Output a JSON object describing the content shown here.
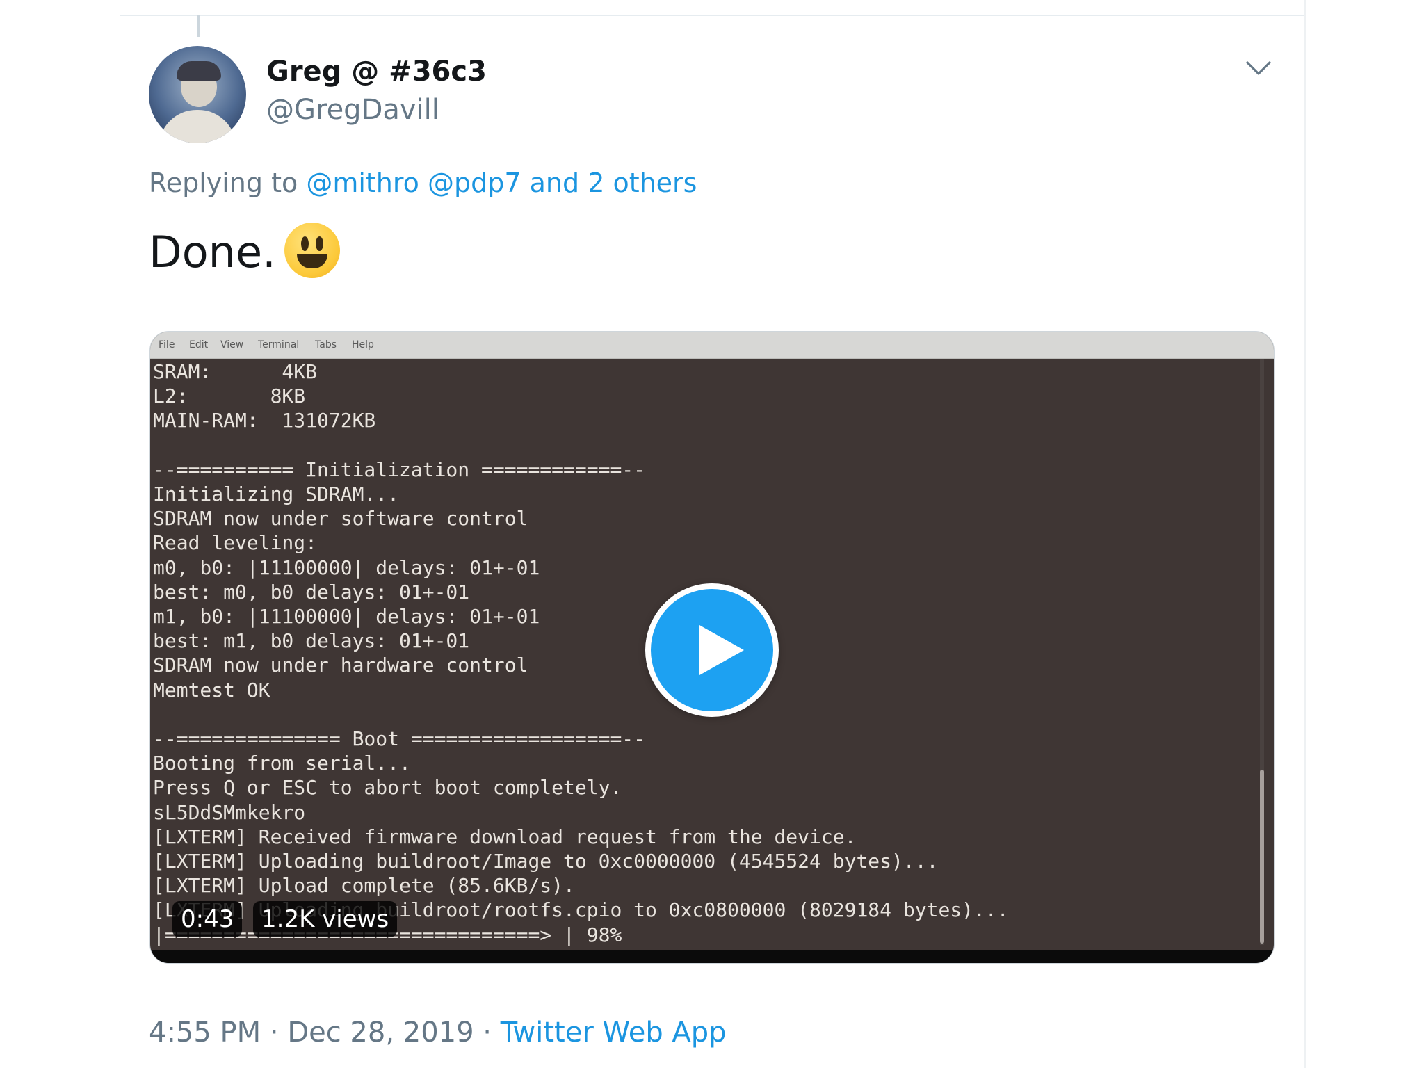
{
  "tweet": {
    "display_name": "Greg @ #36c3",
    "handle": "@GregDavill",
    "replying_prefix": "Replying to",
    "replying_links": "@mithro @pdp7 and 2 others",
    "text": "Done.",
    "emoji_name": "smiley-emoji",
    "timestamp": "4:55 PM · Dec 28, 2019 ·",
    "source": "Twitter Web App"
  },
  "video": {
    "menu": [
      "File",
      "Edit",
      "View",
      "Terminal",
      "Tabs",
      "Help"
    ],
    "duration": "0:43",
    "views": "1.2K views",
    "terminal_lines": [
      "SRAM:      4KB",
      "L2:       8KB",
      "MAIN-RAM:  131072KB",
      "",
      "--========== Initialization ============--",
      "Initializing SDRAM...",
      "SDRAM now under software control",
      "Read leveling:",
      "m0, b0: |11100000| delays: 01+-01",
      "best: m0, b0 delays: 01+-01",
      "m1, b0: |11100000| delays: 01+-01",
      "best: m1, b0 delays: 01+-01",
      "SDRAM now under hardware control",
      "Memtest OK",
      "",
      "--============== Boot ==================--",
      "Booting from serial...",
      "Press Q or ESC to abort boot completely.",
      "sL5DdSMmkekro",
      "[LXTERM] Received firmware download request from the device.",
      "[LXTERM] Uploading buildroot/Image to 0xc0000000 (4545524 bytes)...",
      "[LXTERM] Upload complete (85.6KB/s).",
      "[LXTERM] Uploading buildroot/rootfs.cpio to 0xc0800000 (8029184 bytes)...",
      "|================================> | 98%"
    ]
  },
  "colors": {
    "link": "#1b95e0",
    "secondary_text": "#657786",
    "primary_text": "#14171a",
    "terminal_bg": "#3f3634",
    "play_button": "#1da1f2"
  }
}
